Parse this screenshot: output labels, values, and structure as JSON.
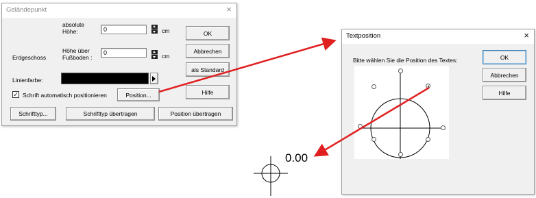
{
  "gelaendepunkt": {
    "title": "Geländepunkt",
    "close": "×",
    "absolute_label_line1": "absolute",
    "absolute_label_line2": "Höhe:",
    "absolute_value": "0",
    "unit_cm_1": "cm",
    "floor_label": "Erdgeschoss",
    "height_label_line1": "Höhe über",
    "height_label_line2": "Fußboden :",
    "height_value": "0",
    "unit_cm_2": "cm",
    "line_color_label": "Linienfarbe:",
    "line_color": "#000000",
    "auto_position_label": "Schrift automatisch positionieren",
    "auto_position_checked": "✓",
    "buttons": {
      "ok": "OK",
      "cancel": "Abbrechen",
      "as_default": "als Standard",
      "help": "Hilfe",
      "position": "Position...",
      "font_type": "Schrifttyp...",
      "transfer_font": "Schrifttyp übertragen",
      "transfer_position": "Position übertragen"
    }
  },
  "textposition": {
    "title": "Textposition",
    "close": "×",
    "prompt": "Bitte wählen Sie die Position des Textes:",
    "buttons": {
      "ok": "OK",
      "cancel": "Abbrechen",
      "help": "Hilfe"
    }
  },
  "canvas": {
    "label": "0.00"
  },
  "colors": {
    "arrow": "#e02020",
    "selection_blue": "#3c7fb1"
  }
}
